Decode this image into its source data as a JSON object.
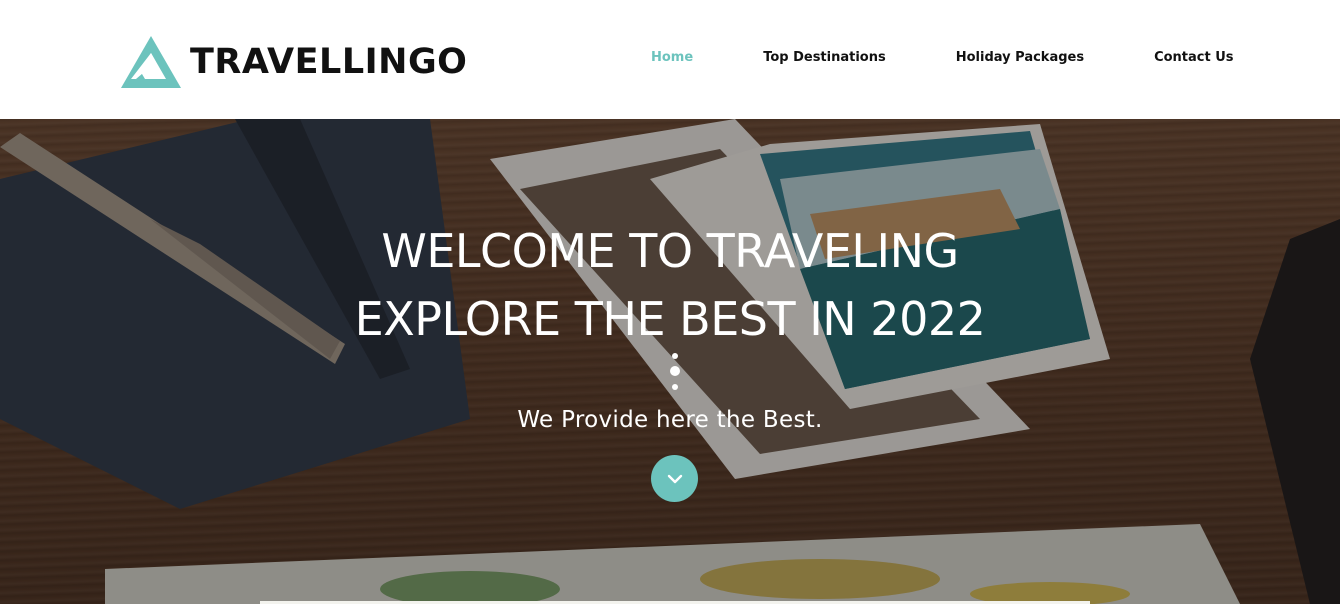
{
  "brand": {
    "name": "TRAVELLINGO",
    "accent_color": "#6cc3bd"
  },
  "nav": {
    "items": [
      {
        "label": "Home",
        "active": true
      },
      {
        "label": "Top Destinations",
        "active": false
      },
      {
        "label": "Holiday Packages",
        "active": false
      },
      {
        "label": "Contact Us",
        "active": false
      }
    ]
  },
  "hero": {
    "title_line1": "WELCOME TO TRAVELING",
    "title_line2": "EXPLORE THE BEST IN 2022",
    "subtitle": "We Provide here the Best.",
    "scroll_icon": "chevron-down-icon",
    "background": "photo of notebook, pen, travel photos and world map on wooden table"
  }
}
